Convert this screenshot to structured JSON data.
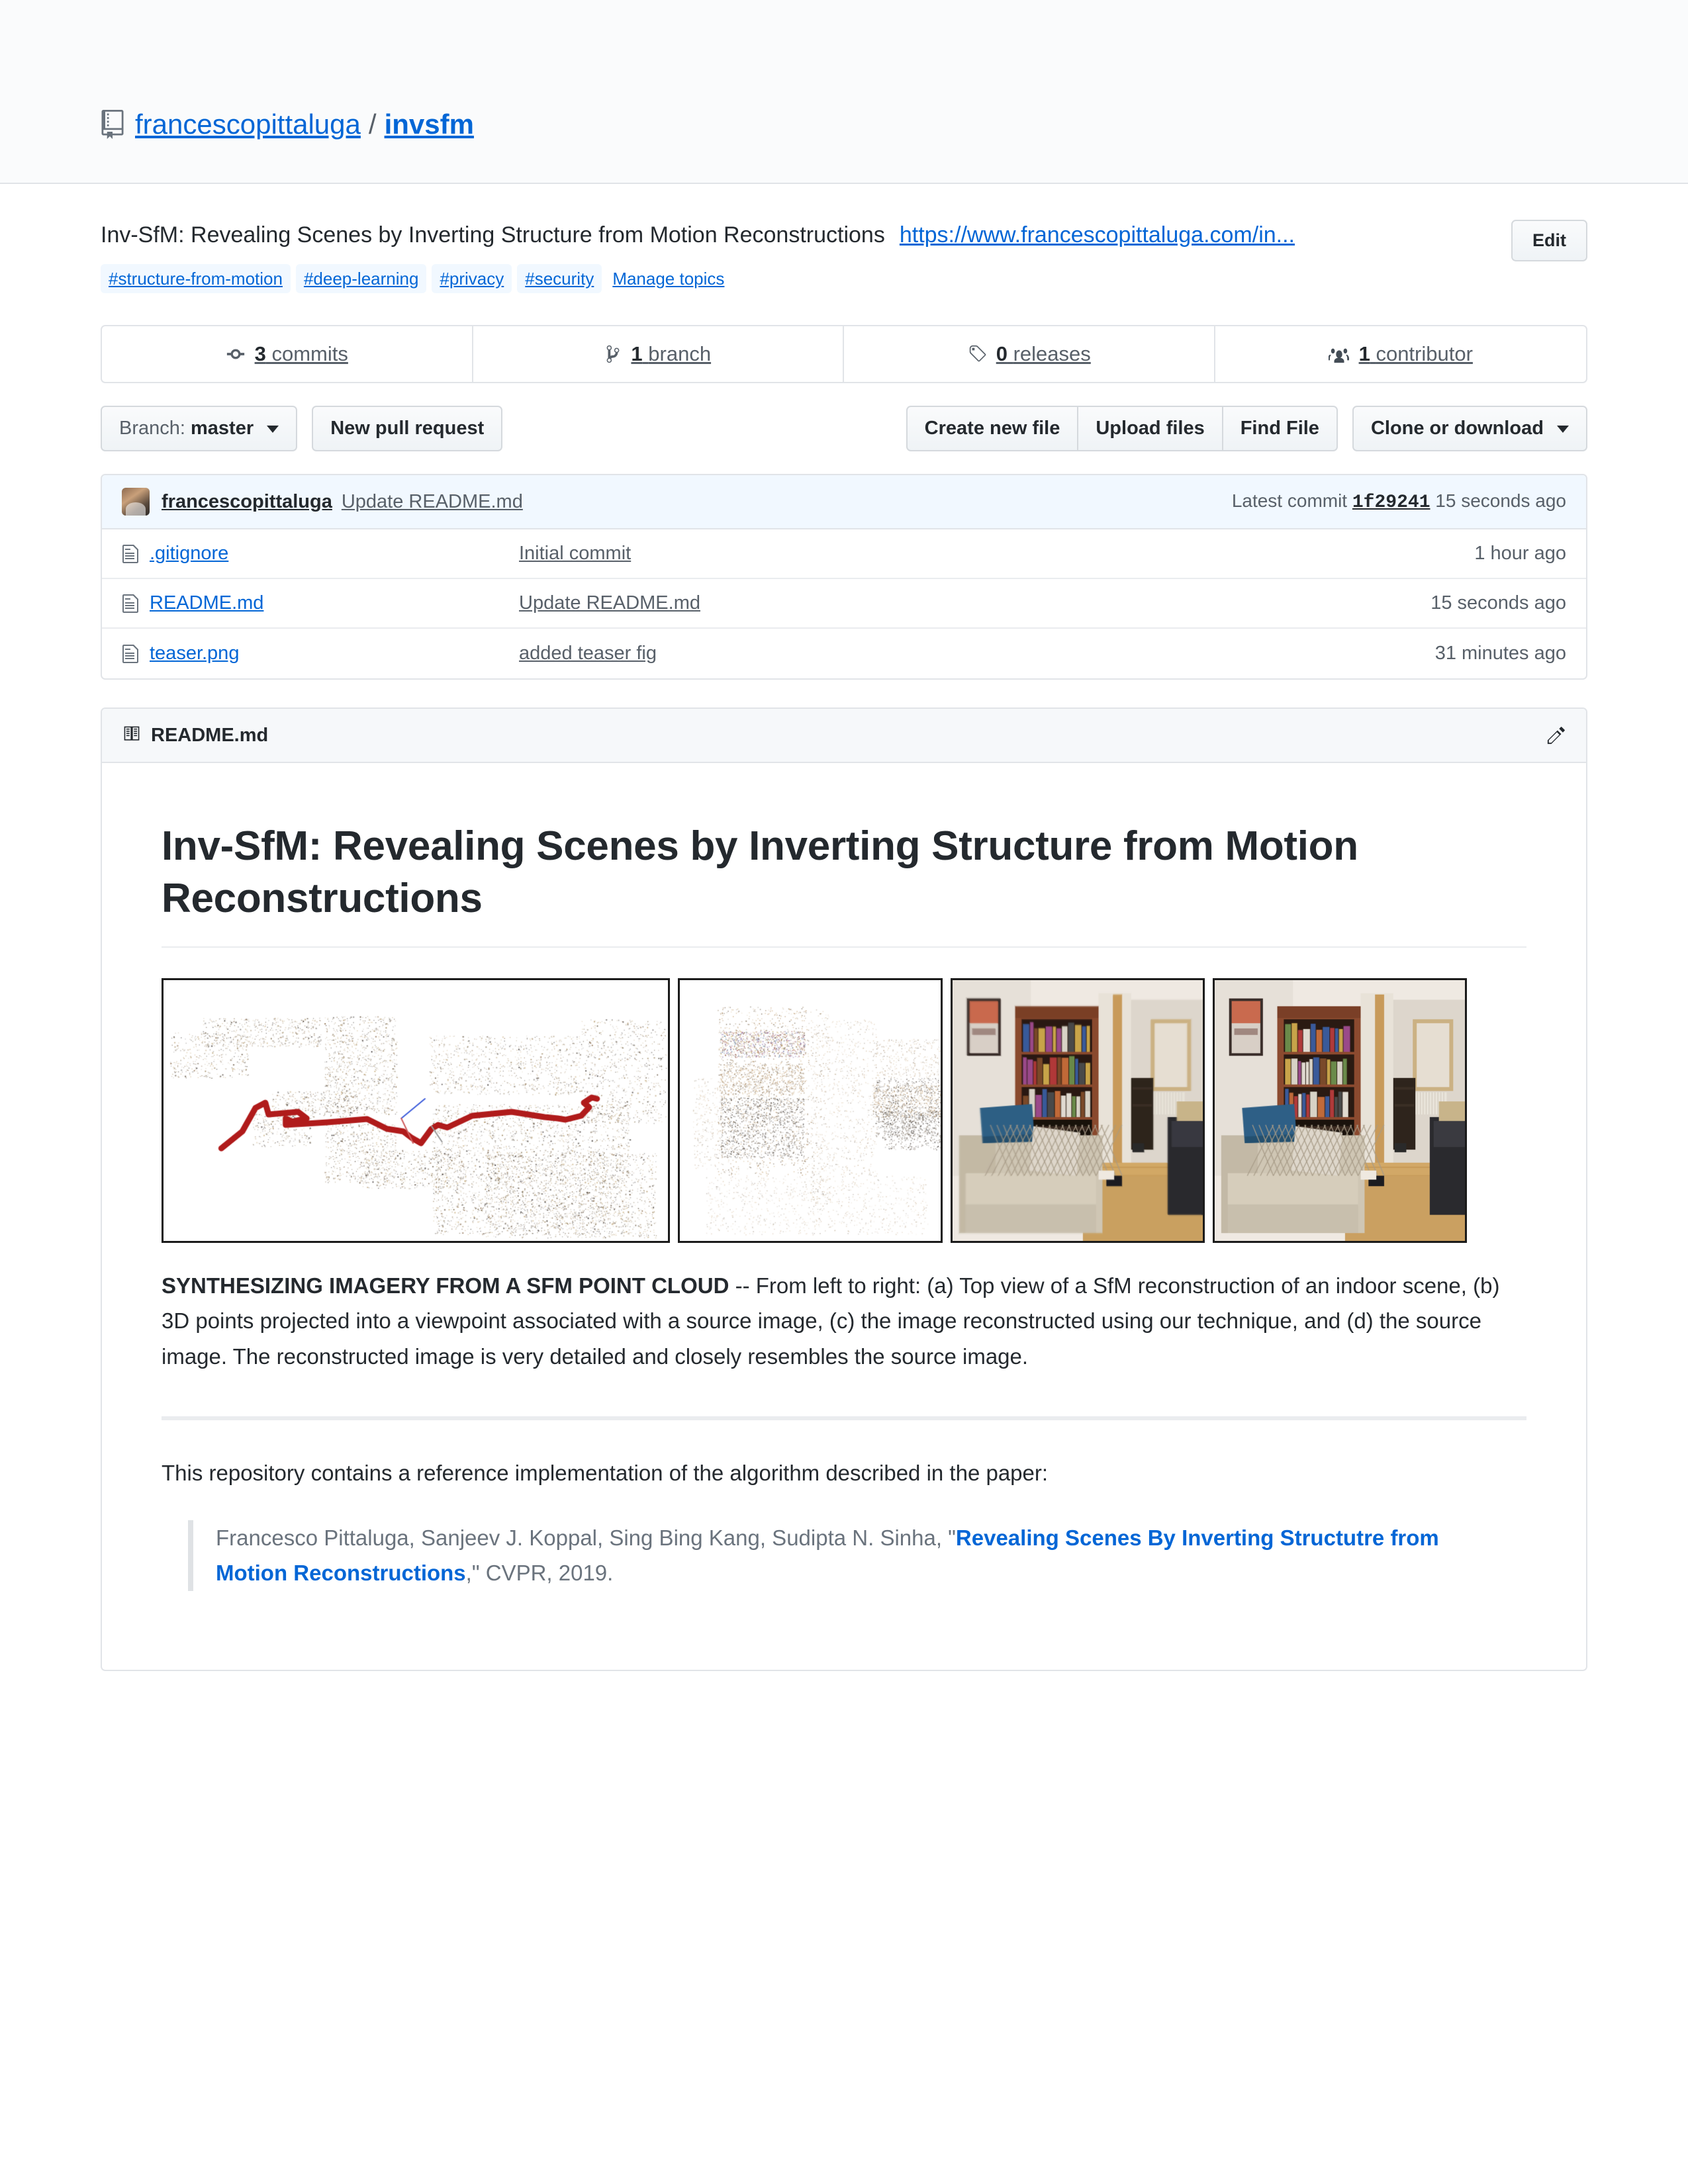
{
  "header": {
    "owner": "francescopittaluga",
    "separator": "/",
    "repo": "invsfm",
    "repo_icon": "repo-book-icon"
  },
  "description": {
    "text": "Inv-SfM: Revealing Scenes by Inverting Structure from Motion Reconstructions",
    "url": "https://www.francescopittaluga.com/in...",
    "edit_label": "Edit",
    "topics": [
      "#structure-from-motion",
      "#deep-learning",
      "#privacy",
      "#security"
    ],
    "manage_topics": "Manage topics"
  },
  "stats": [
    {
      "count": "3",
      "label": "commits",
      "icon": "commit-icon"
    },
    {
      "count": "1",
      "label": "branch",
      "icon": "branch-icon"
    },
    {
      "count": "0",
      "label": "releases",
      "icon": "tag-icon"
    },
    {
      "count": "1",
      "label": "contributor",
      "icon": "people-icon"
    }
  ],
  "toolbar": {
    "branch_prefix": "Branch:",
    "branch_name": "master",
    "new_pull_request": "New pull request",
    "create_new_file": "Create new file",
    "upload_files": "Upload files",
    "find_file": "Find File",
    "clone_or_download": "Clone or download"
  },
  "commit_bar": {
    "author": "francescopittaluga",
    "message": "Update README.md",
    "latest_commit_label": "Latest commit",
    "sha": "1f29241",
    "time": "15 seconds ago"
  },
  "files": [
    {
      "name": ".gitignore",
      "message": "Initial commit",
      "time": "1 hour ago"
    },
    {
      "name": "README.md",
      "message": "Update README.md",
      "time": "15 seconds ago"
    },
    {
      "name": "teaser.png",
      "message": "added teaser fig",
      "time": "31 minutes ago"
    }
  ],
  "readme": {
    "header_title": "README.md",
    "edit_icon": "pencil-icon",
    "heading": "Inv-SfM: Revealing Scenes by Inverting Structure from Motion Reconstructions",
    "teaser_panels": [
      {
        "id": "a",
        "alt": "Top view of SfM point cloud reconstruction with red camera trajectory"
      },
      {
        "id": "b",
        "alt": "3D points projected into a source image viewpoint"
      },
      {
        "id": "c",
        "alt": "Reconstructed image of indoor living room with bookshelf and sofa"
      },
      {
        "id": "d",
        "alt": "Source image of indoor living room with bookshelf and sofa"
      }
    ],
    "caption_bold": "SYNTHESIZING IMAGERY FROM A SFM POINT CLOUD",
    "caption_rest": " -- From left to right: (a) Top view of a SfM reconstruction of an indoor scene, (b) 3D points projected into a viewpoint associated with a source image, (c) the image reconstructed using our technique, and (d) the source image. The reconstructed image is very detailed and closely resembles the source image.",
    "intro_paragraph": "This repository contains a reference implementation of the algorithm described in the paper:",
    "citation_authors": "Francesco Pittaluga, Sanjeev J. Koppal, Sing Bing Kang, Sudipta N. Sinha, \"",
    "citation_link": "Revealing Scenes By Inverting Structutre from Motion Reconstructions",
    "citation_suffix": ",\" CVPR, 2019."
  },
  "colors": {
    "link": "#0366d6",
    "muted": "#586069",
    "border": "#e1e4e8",
    "topic_bg": "#f1f8ff",
    "commit_bar_bg": "#f1f8ff",
    "header_bg": "#fafbfc"
  }
}
